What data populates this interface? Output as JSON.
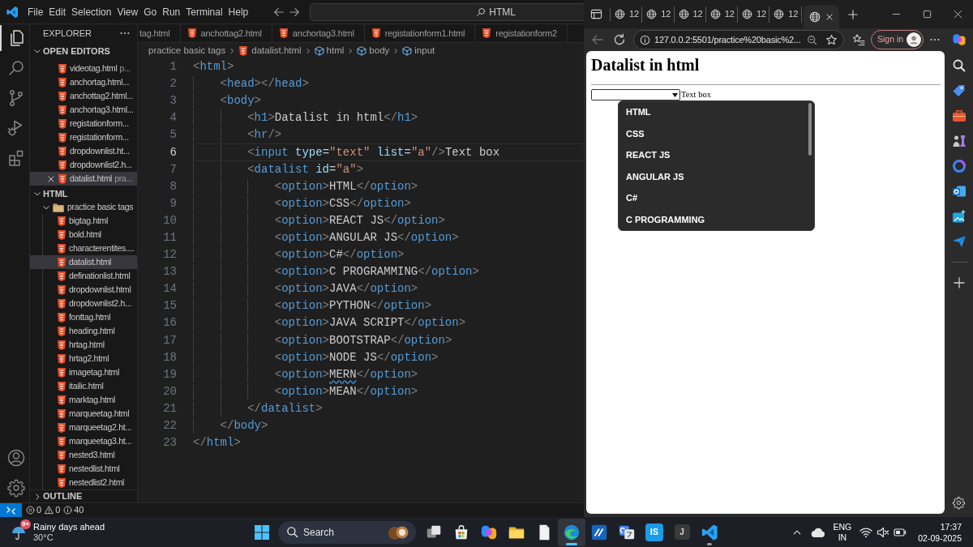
{
  "vscode": {
    "menu": [
      "File",
      "Edit",
      "Selection",
      "View",
      "Go",
      "Run",
      "Terminal",
      "Help"
    ],
    "command_center": "HTML",
    "activity_bar": [
      {
        "kind": "explorer",
        "selected": true
      },
      {
        "kind": "search",
        "selected": false
      },
      {
        "kind": "source_control",
        "selected": false
      },
      {
        "kind": "run_debug",
        "selected": false
      },
      {
        "kind": "extensions",
        "selected": false
      },
      {
        "kind": "account",
        "selected": false
      },
      {
        "kind": "settings",
        "selected": false
      }
    ],
    "explorer": {
      "title": "EXPLORER",
      "open_editors": {
        "title": "OPEN EDITORS",
        "expanded": true,
        "items": [
          {
            "name": "videotag.html",
            "description": "p...",
            "selected": false
          },
          {
            "name": "anchortag.html...",
            "selected": false
          },
          {
            "name": "anchottag2.html...",
            "selected": false
          },
          {
            "name": "anchortag3.html...",
            "selected": false
          },
          {
            "name": "registationform...",
            "selected": false
          },
          {
            "name": "registationform...",
            "selected": false
          },
          {
            "name": "dropdownlist.ht...",
            "selected": false
          },
          {
            "name": "dropdownlist2.h...",
            "selected": false
          },
          {
            "name": "datalist.html",
            "description": "pra...",
            "selected": true
          }
        ]
      },
      "folder_view": {
        "title": "HTML",
        "expanded": true,
        "children": [
          {
            "name": "practice basic tags",
            "kind": "folder",
            "expanded": true,
            "selected": false,
            "children": [
              {
                "name": "bigtag.html",
                "kind": "file",
                "selected": false
              },
              {
                "name": "bold.html",
                "kind": "file",
                "selected": false
              },
              {
                "name": "characterentites....",
                "kind": "file",
                "selected": false
              },
              {
                "name": "datalist.html",
                "kind": "file",
                "selected": true
              },
              {
                "name": "definationlist.html",
                "kind": "file",
                "selected": false
              },
              {
                "name": "dropdownlist.html",
                "kind": "file",
                "selected": false
              },
              {
                "name": "dropdownlist2.h...",
                "kind": "file",
                "selected": false
              },
              {
                "name": "fonttag.html",
                "kind": "file",
                "selected": false
              },
              {
                "name": "heading.html",
                "kind": "file",
                "selected": false
              },
              {
                "name": "hrtag.html",
                "kind": "file",
                "selected": false
              },
              {
                "name": "hrtag2.html",
                "kind": "file",
                "selected": false
              },
              {
                "name": "imagetag.html",
                "kind": "file",
                "selected": false
              },
              {
                "name": "itailic.html",
                "kind": "file",
                "selected": false
              },
              {
                "name": "marktag.html",
                "kind": "file",
                "selected": false
              },
              {
                "name": "marqueetag.html",
                "kind": "file",
                "selected": false
              },
              {
                "name": "marqueetag2.ht...",
                "kind": "file",
                "selected": false
              },
              {
                "name": "marqueetag3.ht...",
                "kind": "file",
                "selected": false
              },
              {
                "name": "nested3.html",
                "kind": "file",
                "selected": false
              },
              {
                "name": "nestedlist.html",
                "kind": "file",
                "selected": false
              },
              {
                "name": "nestedlist2.html",
                "kind": "file",
                "selected": false
              }
            ]
          }
        ]
      },
      "outline": {
        "title": "OUTLINE",
        "expanded": false
      }
    },
    "editor": {
      "tabs": [
        {
          "label": "tag.html",
          "clipped": true,
          "selected": false
        },
        {
          "label": "anchottag2.html",
          "clipped": false,
          "selected": false
        },
        {
          "label": "anchortag3.html",
          "clipped": false,
          "selected": false
        },
        {
          "label": "registationform1.html",
          "clipped": false,
          "selected": false
        },
        {
          "label": "registationform2",
          "clipped": false,
          "selected": false
        }
      ],
      "breadcrumb": [
        {
          "label": "practice basic tags",
          "kind": "folder"
        },
        {
          "label": "datalist.html",
          "kind": "file"
        },
        {
          "label": "html",
          "kind": "symbol"
        },
        {
          "label": "body",
          "kind": "symbol"
        },
        {
          "label": "input",
          "kind": "symbol"
        }
      ],
      "lines": [
        {
          "number": "1",
          "current": false,
          "tokens": [
            {
              "kind": "punct",
              "text": "<"
            },
            {
              "kind": "tag",
              "text": "html"
            },
            {
              "kind": "punct",
              "text": ">"
            }
          ]
        },
        {
          "number": "2",
          "current": false,
          "tokens": [
            {
              "kind": "punct",
              "text": "    <"
            },
            {
              "kind": "tag",
              "text": "head"
            },
            {
              "kind": "punct",
              "text": "></"
            },
            {
              "kind": "tag",
              "text": "head"
            },
            {
              "kind": "punct",
              "text": ">"
            }
          ]
        },
        {
          "number": "3",
          "current": false,
          "tokens": [
            {
              "kind": "punct",
              "text": "    <"
            },
            {
              "kind": "tag",
              "text": "body"
            },
            {
              "kind": "punct",
              "text": ">"
            }
          ]
        },
        {
          "number": "4",
          "current": false,
          "tokens": [
            {
              "kind": "punct",
              "text": "        <"
            },
            {
              "kind": "tag",
              "text": "h1"
            },
            {
              "kind": "punct",
              "text": ">"
            },
            {
              "kind": "text",
              "text": "Datalist in html"
            },
            {
              "kind": "punct",
              "text": "</"
            },
            {
              "kind": "tag",
              "text": "h1"
            },
            {
              "kind": "punct",
              "text": ">"
            }
          ]
        },
        {
          "number": "5",
          "current": false,
          "tokens": [
            {
              "kind": "punct",
              "text": "        <"
            },
            {
              "kind": "tag",
              "text": "hr"
            },
            {
              "kind": "punct",
              "text": "/>"
            }
          ]
        },
        {
          "number": "6",
          "current": true,
          "tokens": [
            {
              "kind": "punct",
              "text": "        <"
            },
            {
              "kind": "tag",
              "text": "input"
            },
            {
              "kind": "attr",
              "text": " type"
            },
            {
              "kind": "text",
              "text": "="
            },
            {
              "kind": "string",
              "text": "\"text\""
            },
            {
              "kind": "attr",
              "text": " list"
            },
            {
              "kind": "text",
              "text": "="
            },
            {
              "kind": "string",
              "text": "\"a\""
            },
            {
              "kind": "punct",
              "text": "/>"
            },
            {
              "kind": "text",
              "text": "Text box"
            }
          ]
        },
        {
          "number": "7",
          "current": false,
          "tokens": [
            {
              "kind": "punct",
              "text": "        <"
            },
            {
              "kind": "tag",
              "text": "datalist"
            },
            {
              "kind": "attr",
              "text": " id"
            },
            {
              "kind": "text",
              "text": "="
            },
            {
              "kind": "string",
              "text": "\"a\""
            },
            {
              "kind": "punct",
              "text": ">"
            }
          ]
        },
        {
          "number": "8",
          "current": false,
          "tokens": [
            {
              "kind": "punct",
              "text": "            <"
            },
            {
              "kind": "tag",
              "text": "option"
            },
            {
              "kind": "punct",
              "text": ">"
            },
            {
              "kind": "text",
              "text": "HTML"
            },
            {
              "kind": "punct",
              "text": "</"
            },
            {
              "kind": "tag",
              "text": "option"
            },
            {
              "kind": "punct",
              "text": ">"
            }
          ]
        },
        {
          "number": "9",
          "current": false,
          "tokens": [
            {
              "kind": "punct",
              "text": "            <"
            },
            {
              "kind": "tag",
              "text": "option"
            },
            {
              "kind": "punct",
              "text": ">"
            },
            {
              "kind": "text",
              "text": "CSS"
            },
            {
              "kind": "punct",
              "text": "</"
            },
            {
              "kind": "tag",
              "text": "option"
            },
            {
              "kind": "punct",
              "text": ">"
            }
          ]
        },
        {
          "number": "10",
          "current": false,
          "tokens": [
            {
              "kind": "punct",
              "text": "            <"
            },
            {
              "kind": "tag",
              "text": "option"
            },
            {
              "kind": "punct",
              "text": ">"
            },
            {
              "kind": "text",
              "text": "REACT JS"
            },
            {
              "kind": "punct",
              "text": "</"
            },
            {
              "kind": "tag",
              "text": "option"
            },
            {
              "kind": "punct",
              "text": ">"
            }
          ]
        },
        {
          "number": "11",
          "current": false,
          "tokens": [
            {
              "kind": "punct",
              "text": "            <"
            },
            {
              "kind": "tag",
              "text": "option"
            },
            {
              "kind": "punct",
              "text": ">"
            },
            {
              "kind": "text",
              "text": "ANGULAR JS"
            },
            {
              "kind": "punct",
              "text": "</"
            },
            {
              "kind": "tag",
              "text": "option"
            },
            {
              "kind": "punct",
              "text": ">"
            }
          ]
        },
        {
          "number": "12",
          "current": false,
          "tokens": [
            {
              "kind": "punct",
              "text": "            <"
            },
            {
              "kind": "tag",
              "text": "option"
            },
            {
              "kind": "punct",
              "text": ">"
            },
            {
              "kind": "text",
              "text": "C#"
            },
            {
              "kind": "punct",
              "text": "</"
            },
            {
              "kind": "tag",
              "text": "option"
            },
            {
              "kind": "punct",
              "text": ">"
            }
          ]
        },
        {
          "number": "13",
          "current": false,
          "tokens": [
            {
              "kind": "punct",
              "text": "            <"
            },
            {
              "kind": "tag",
              "text": "option"
            },
            {
              "kind": "punct",
              "text": ">"
            },
            {
              "kind": "text",
              "text": "C PROGRAMMING"
            },
            {
              "kind": "punct",
              "text": "</"
            },
            {
              "kind": "tag",
              "text": "option"
            },
            {
              "kind": "punct",
              "text": ">"
            }
          ]
        },
        {
          "number": "14",
          "current": false,
          "tokens": [
            {
              "kind": "punct",
              "text": "            <"
            },
            {
              "kind": "tag",
              "text": "option"
            },
            {
              "kind": "punct",
              "text": ">"
            },
            {
              "kind": "text",
              "text": "JAVA"
            },
            {
              "kind": "punct",
              "text": "</"
            },
            {
              "kind": "tag",
              "text": "option"
            },
            {
              "kind": "punct",
              "text": ">"
            }
          ]
        },
        {
          "number": "15",
          "current": false,
          "tokens": [
            {
              "kind": "punct",
              "text": "            <"
            },
            {
              "kind": "tag",
              "text": "option"
            },
            {
              "kind": "punct",
              "text": ">"
            },
            {
              "kind": "text",
              "text": "PYTHON"
            },
            {
              "kind": "punct",
              "text": "</"
            },
            {
              "kind": "tag",
              "text": "option"
            },
            {
              "kind": "punct",
              "text": ">"
            }
          ]
        },
        {
          "number": "16",
          "current": false,
          "tokens": [
            {
              "kind": "punct",
              "text": "            <"
            },
            {
              "kind": "tag",
              "text": "option"
            },
            {
              "kind": "punct",
              "text": ">"
            },
            {
              "kind": "text",
              "text": "JAVA SCRIPT"
            },
            {
              "kind": "punct",
              "text": "</"
            },
            {
              "kind": "tag",
              "text": "option"
            },
            {
              "kind": "punct",
              "text": ">"
            }
          ]
        },
        {
          "number": "17",
          "current": false,
          "tokens": [
            {
              "kind": "punct",
              "text": "            <"
            },
            {
              "kind": "tag",
              "text": "option"
            },
            {
              "kind": "punct",
              "text": ">"
            },
            {
              "kind": "text",
              "text": "BOOTSTRAP"
            },
            {
              "kind": "punct",
              "text": "</"
            },
            {
              "kind": "tag",
              "text": "option"
            },
            {
              "kind": "punct",
              "text": ">"
            }
          ]
        },
        {
          "number": "18",
          "current": false,
          "tokens": [
            {
              "kind": "punct",
              "text": "            <"
            },
            {
              "kind": "tag",
              "text": "option"
            },
            {
              "kind": "punct",
              "text": ">"
            },
            {
              "kind": "text",
              "text": "NODE JS"
            },
            {
              "kind": "punct",
              "text": "</"
            },
            {
              "kind": "tag",
              "text": "option"
            },
            {
              "kind": "punct",
              "text": ">"
            }
          ]
        },
        {
          "number": "19",
          "current": false,
          "tokens": [
            {
              "kind": "punct",
              "text": "            <"
            },
            {
              "kind": "tag",
              "text": "option"
            },
            {
              "kind": "punct",
              "text": ">"
            },
            {
              "kind": "flagged",
              "text": "MERN"
            },
            {
              "kind": "punct",
              "text": "</"
            },
            {
              "kind": "tag",
              "text": "option"
            },
            {
              "kind": "punct",
              "text": ">"
            }
          ]
        },
        {
          "number": "20",
          "current": false,
          "tokens": [
            {
              "kind": "punct",
              "text": "            <"
            },
            {
              "kind": "tag",
              "text": "option"
            },
            {
              "kind": "punct",
              "text": ">"
            },
            {
              "kind": "text",
              "text": "MEAN"
            },
            {
              "kind": "punct",
              "text": "</"
            },
            {
              "kind": "tag",
              "text": "option"
            },
            {
              "kind": "punct",
              "text": ">"
            }
          ]
        },
        {
          "number": "21",
          "current": false,
          "tokens": [
            {
              "kind": "punct",
              "text": "        </"
            },
            {
              "kind": "tag",
              "text": "datalist"
            },
            {
              "kind": "punct",
              "text": ">"
            }
          ]
        },
        {
          "number": "22",
          "current": false,
          "tokens": [
            {
              "kind": "punct",
              "text": "    </"
            },
            {
              "kind": "tag",
              "text": "body"
            },
            {
              "kind": "punct",
              "text": ">"
            }
          ]
        },
        {
          "number": "23",
          "current": false,
          "tokens": [
            {
              "kind": "punct",
              "text": "</"
            },
            {
              "kind": "tag",
              "text": "html"
            },
            {
              "kind": "punct",
              "text": ">"
            }
          ]
        }
      ]
    },
    "status_bar": {
      "errors": "0",
      "warnings": "0",
      "infos": "40"
    }
  },
  "browser": {
    "tabs": [
      {
        "label": "12",
        "selected": false
      },
      {
        "label": "12",
        "selected": false
      },
      {
        "label": "12",
        "selected": false
      },
      {
        "label": "12",
        "selected": false
      },
      {
        "label": "12",
        "selected": false
      },
      {
        "label": "12",
        "selected": false
      },
      {
        "selected": true
      }
    ],
    "address": "127.0.0.2:5501/practice%20basic%2...",
    "sign_in": "Sign in",
    "page": {
      "heading": "Datalist in html",
      "input_label": "Text box",
      "suggestions": [
        "HTML",
        "CSS",
        "REACT JS",
        "ANGULAR JS",
        "C#",
        "C PROGRAMMING"
      ]
    }
  },
  "taskbar": {
    "weather": {
      "badge": "9+",
      "title": "Rainy days ahead",
      "temperature": "30°C"
    },
    "search": {
      "placeholder": "Search"
    },
    "apps": [
      {
        "kind": "task_view",
        "running": false,
        "selected": false
      },
      {
        "kind": "store",
        "running": false,
        "selected": false
      },
      {
        "kind": "copilot",
        "running": false,
        "selected": false
      },
      {
        "kind": "file_explorer",
        "running": false,
        "selected": false
      },
      {
        "kind": "document",
        "running": false,
        "selected": false
      },
      {
        "kind": "browser",
        "running": true,
        "selected": true
      },
      {
        "kind": "slash_app",
        "running": false,
        "selected": false
      },
      {
        "kind": "translate",
        "running": false,
        "selected": false
      },
      {
        "kind": "letter_tile_blue",
        "label": "IS",
        "running": false,
        "selected": false
      },
      {
        "kind": "letter_tile_dark",
        "label": "J",
        "running": false,
        "selected": false
      },
      {
        "kind": "code_editor",
        "running": true,
        "selected": false
      }
    ],
    "tray": {
      "language": "ENG",
      "region": "IN",
      "time": "17:37",
      "date": "02-09-2025"
    }
  }
}
